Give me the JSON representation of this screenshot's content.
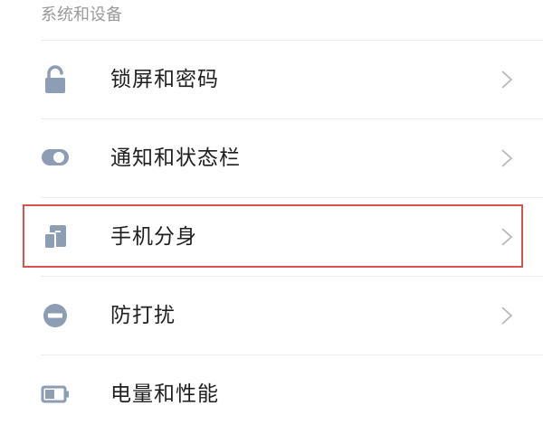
{
  "section": {
    "title": "系统和设备"
  },
  "items": [
    {
      "label": "锁屏和密码",
      "icon": "lock-icon",
      "has_chevron": true
    },
    {
      "label": "通知和状态栏",
      "icon": "toggle-icon",
      "has_chevron": true
    },
    {
      "label": "手机分身",
      "icon": "phone-clone-icon",
      "has_chevron": true,
      "highlighted": true
    },
    {
      "label": "防打扰",
      "icon": "do-not-disturb-icon",
      "has_chevron": true
    },
    {
      "label": "电量和性能",
      "icon": "battery-icon",
      "has_chevron": false
    }
  ],
  "colors": {
    "icon": "#8d9db3",
    "chevron": "#b8b8b8",
    "highlight_border": "#d9534f",
    "divider": "#ececec",
    "label": "#1f1f1f",
    "section_header": "#9a9a9a"
  }
}
